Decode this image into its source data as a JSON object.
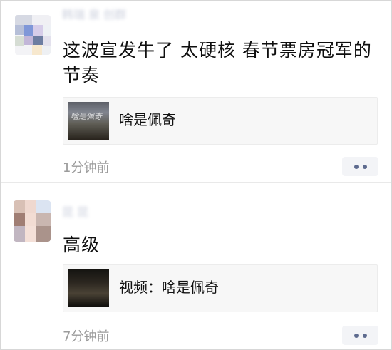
{
  "comments": [
    {
      "nickname": "韩瑞 泉 创群",
      "text": "这波宣发牛了 太硬核 春节票房冠军的节奏",
      "link": {
        "thumbnail_text": "啥是佩奇",
        "title": "啥是佩奇"
      },
      "time": "1分钟前",
      "more_icon": "more-options-icon"
    },
    {
      "nickname": "昆 昆",
      "text": "高级",
      "link": {
        "thumbnail_text": "",
        "title": "视频：啥是佩奇"
      },
      "time": "7分钟前",
      "more_icon": "more-options-icon"
    }
  ],
  "colors": {
    "background": "#ffffff",
    "link_card_background": "#f7f7f7",
    "nickname": "#5d6a95",
    "timestamp": "#9b9b9b",
    "more_button_background": "#f3f4f7",
    "more_button_dots": "#5e6b8f"
  }
}
